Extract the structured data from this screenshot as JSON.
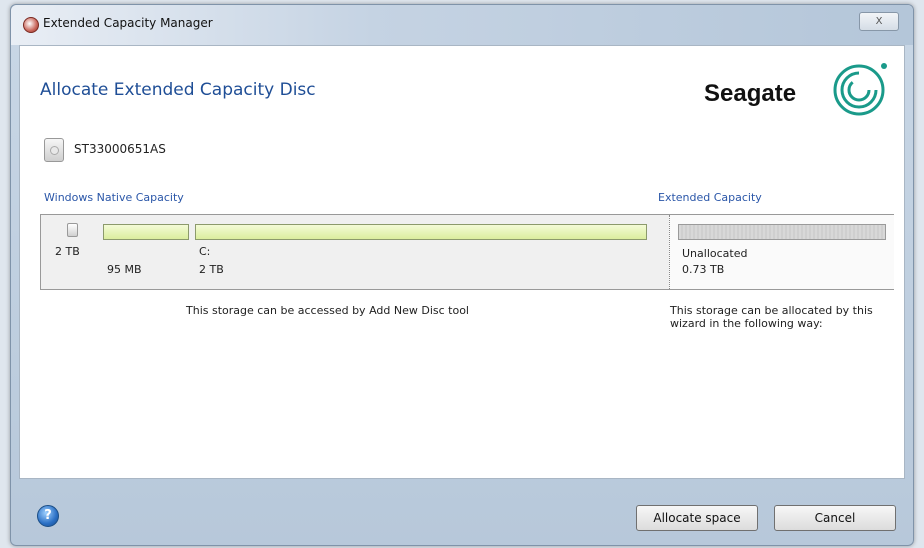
{
  "window": {
    "title": "Extended Capacity Manager",
    "close_label": "X"
  },
  "heading": "Allocate Extended Capacity Disc",
  "brand": {
    "name": "Seagate"
  },
  "disk": {
    "model": "ST33000651AS"
  },
  "sections": {
    "native_label": "Windows Native Capacity",
    "extended_label": "Extended Capacity"
  },
  "partitions": {
    "disk_total": "2 TB",
    "system_reserved": {
      "size": "95 MB"
    },
    "c_drive": {
      "letter": "C:",
      "size": "2 TB"
    },
    "unallocated": {
      "label": "Unallocated",
      "size": "0.73 TB"
    }
  },
  "messages": {
    "native": "This storage can be accessed by Add New Disc tool",
    "extended": "This storage can be allocated by this wizard in the following way:"
  },
  "buttons": {
    "allocate": "Allocate space",
    "cancel": "Cancel",
    "help": "?"
  },
  "colors": {
    "heading": "#1f4e96",
    "partition_fill": "#dbee9e",
    "unallocated_fill": "#d0d0d0",
    "link_blue": "#2a56a8"
  }
}
